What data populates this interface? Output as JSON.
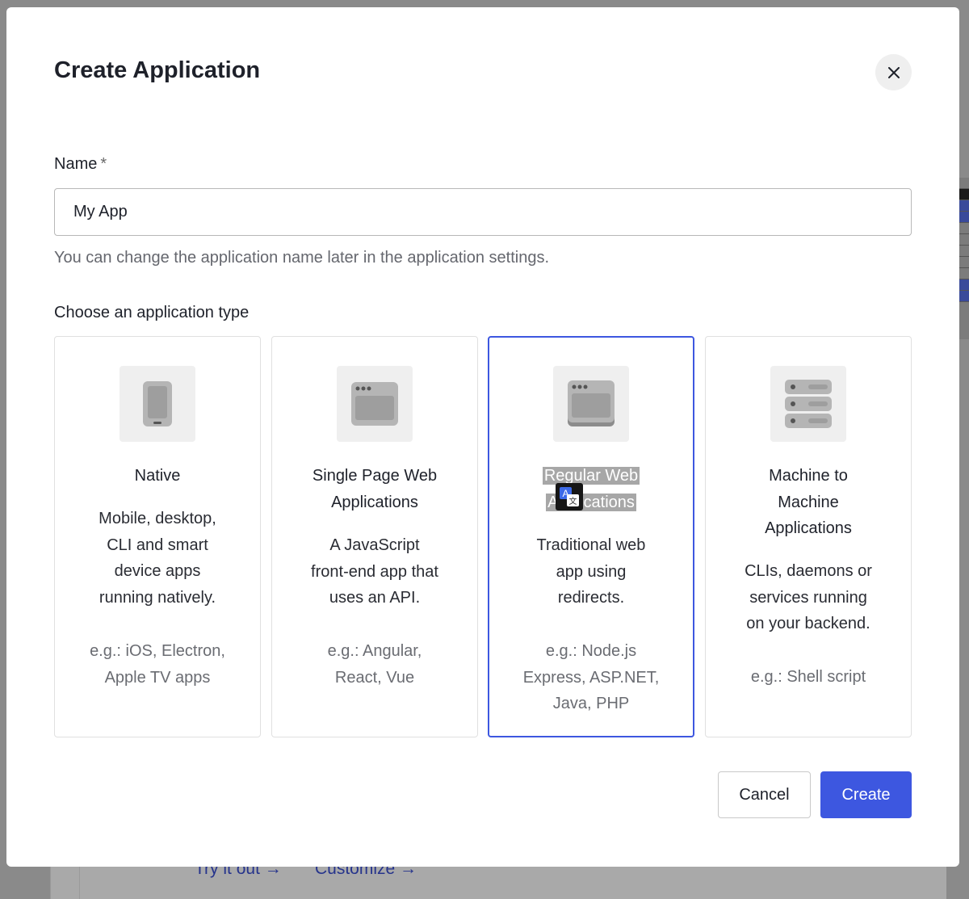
{
  "background": {
    "links": [
      "Try it out →",
      "Customize →"
    ]
  },
  "dialog": {
    "title": "Create Application",
    "close_icon": "close-icon",
    "name_label": "Name",
    "name_required_mark": "*",
    "name_value": "My App",
    "name_helper": "You can change the application name later in the application settings.",
    "type_label": "Choose an application type",
    "selected_type": "Regular Web Applications",
    "types": [
      {
        "icon": "mobile-device-icon",
        "title_lines": [
          "Native"
        ],
        "desc_lines": [
          "Mobile, desktop,",
          "CLI and smart",
          "device apps",
          "running natively."
        ],
        "example_lines": [
          "e.g.: iOS, Electron,",
          "Apple TV apps"
        ]
      },
      {
        "icon": "browser-window-icon",
        "title_lines": [
          "Single Page Web",
          "Applications"
        ],
        "desc_lines": [
          "A JavaScript",
          "front-end app that",
          "uses an API."
        ],
        "example_lines": [
          "e.g.: Angular,",
          "React, Vue"
        ]
      },
      {
        "icon": "web-server-window-icon",
        "title_lines": [
          "Regular Web",
          "Applications"
        ],
        "desc_lines": [
          "Traditional web",
          "app using",
          "redirects."
        ],
        "example_lines": [
          "e.g.: Node.js",
          "Express, ASP.NET,",
          "Java, PHP"
        ]
      },
      {
        "icon": "server-rack-icon",
        "title_lines": [
          "Machine to",
          "Machine",
          "Applications"
        ],
        "desc_lines": [
          "CLIs, daemons or",
          "services running",
          "on your backend."
        ],
        "example_lines": [
          "e.g.: Shell script"
        ]
      }
    ],
    "cancel_label": "Cancel",
    "create_label": "Create",
    "accent_color": "#3d57e0"
  }
}
